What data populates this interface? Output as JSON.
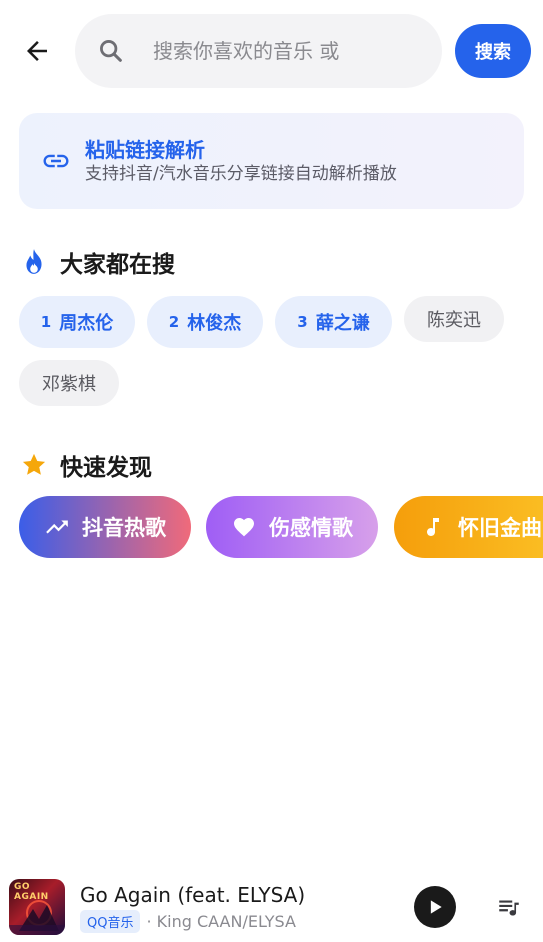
{
  "search": {
    "placeholder": "搜索你喜欢的音乐 或",
    "button_label": "搜索"
  },
  "paste_card": {
    "title": "粘贴链接解析",
    "subtitle": "支持抖音/汽水音乐分享链接自动解析播放"
  },
  "trending": {
    "title": "大家都在搜",
    "items": [
      {
        "rank": "1",
        "label": "周杰伦"
      },
      {
        "rank": "2",
        "label": "林俊杰"
      },
      {
        "rank": "3",
        "label": "薛之谦"
      },
      {
        "rank": "",
        "label": "陈奕迅"
      },
      {
        "rank": "",
        "label": "邓紫棋"
      }
    ]
  },
  "discover": {
    "title": "快速发现",
    "items": [
      {
        "label": "抖音热歌",
        "icon": "trending-up-icon",
        "colors": [
          "#3b5ee8",
          "#f06a7a"
        ]
      },
      {
        "label": "伤感情歌",
        "icon": "heart-icon",
        "colors": [
          "#9f5ef5",
          "#d7a0ea"
        ]
      },
      {
        "label": "怀旧金曲",
        "icon": "music-note-icon",
        "colors": [
          "#f59e0b",
          "#fbbf24"
        ]
      }
    ]
  },
  "player": {
    "cover_text": "GO AGAIN",
    "title": "Go Again (feat. ELYSA)",
    "source": "QQ音乐",
    "artist": "· King CAAN/ELYSA"
  },
  "colors": {
    "accent": "#2563eb",
    "search_bg": "#f3f3f5",
    "chip_ranked_bg": "#e8effd",
    "chip_plain_bg": "#f1f1f3",
    "fire": "#2563eb",
    "star": "#f5a70b"
  }
}
